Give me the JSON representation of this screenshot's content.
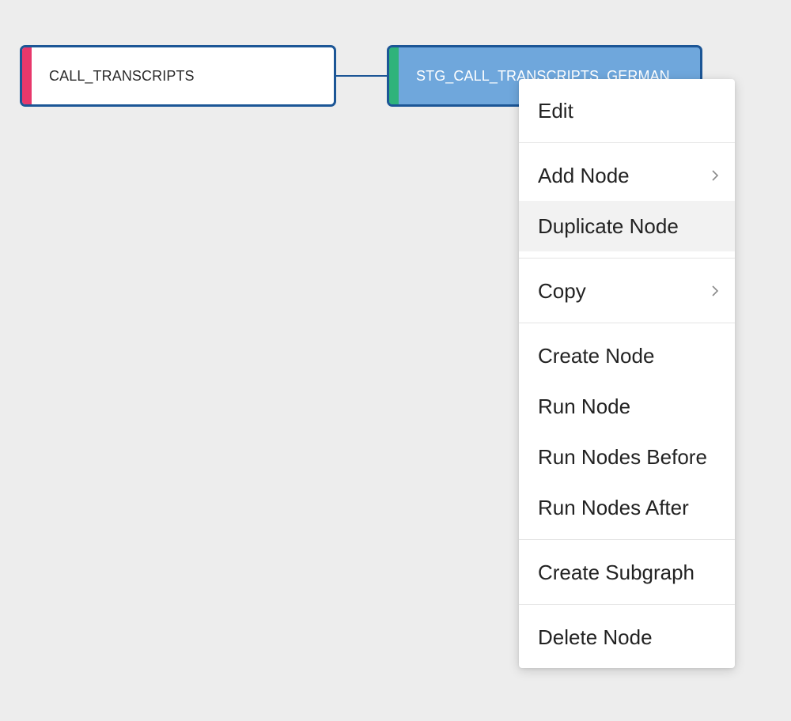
{
  "canvas": {
    "nodes": [
      {
        "label": "CALL_TRANSCRIPTS",
        "stripe_color": "#e8386b"
      },
      {
        "label": "STG_CALL_TRANSCRIPTS_GERMAN",
        "stripe_color": "#2fb37b"
      }
    ]
  },
  "context_menu": {
    "edit": "Edit",
    "add_node": "Add Node",
    "duplicate_node": "Duplicate Node",
    "copy": "Copy",
    "create_node": "Create Node",
    "run_node": "Run Node",
    "run_nodes_before": "Run Nodes Before",
    "run_nodes_after": "Run Nodes After",
    "create_subgraph": "Create Subgraph",
    "delete_node": "Delete Node",
    "hovered_item": "Duplicate Node",
    "submenu_icon": "chevron-right-icon"
  },
  "colors": {
    "canvas_bg": "#ededed",
    "node_border": "#1c5696",
    "selected_node_fill": "#6fa7dc",
    "menu_hover": "#f2f2f2"
  }
}
